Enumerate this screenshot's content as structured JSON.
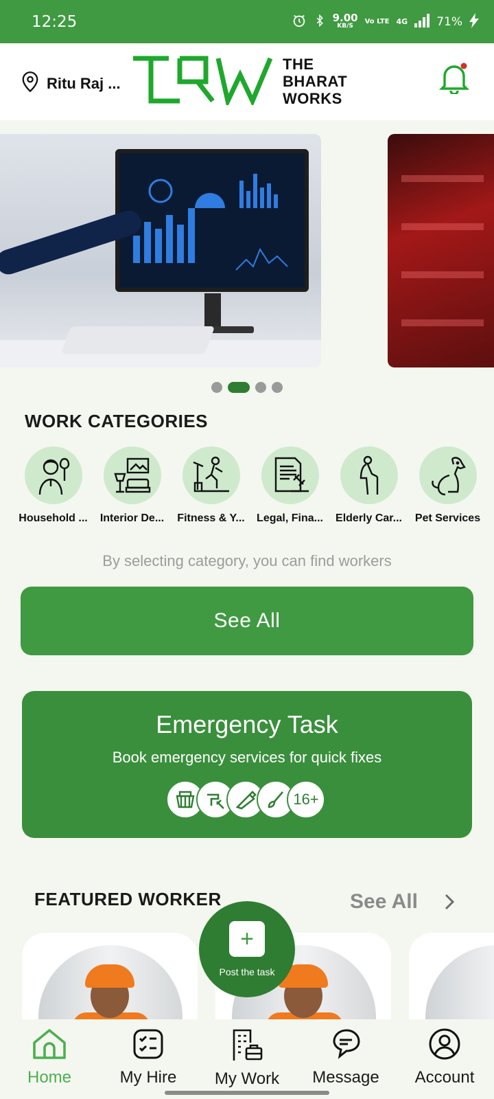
{
  "status_bar": {
    "time": "12:25",
    "net_speed": "9.00",
    "net_unit": "KB/S",
    "volte": "Vo LTE",
    "network": "4G",
    "battery": "71%"
  },
  "header": {
    "location": "Ritu Raj ...",
    "logo_words": [
      "THE",
      "BHARAT",
      "WORKS"
    ],
    "brand_color": "#1fa82c",
    "notification_dot_color": "#d32f2f"
  },
  "banner": {
    "active_slide_index": 1,
    "slide_count": 4
  },
  "categories": {
    "title": "WORK CATEGORIES",
    "items": [
      {
        "label": "Household ...",
        "icon": "housekeeper-icon"
      },
      {
        "label": "Interior De...",
        "icon": "interior-design-icon"
      },
      {
        "label": "Fitness & Y...",
        "icon": "fitness-icon"
      },
      {
        "label": "Legal, Fina...",
        "icon": "legal-document-icon"
      },
      {
        "label": "Elderly Car...",
        "icon": "elderly-care-icon"
      },
      {
        "label": "Pet Services",
        "icon": "dog-icon"
      }
    ],
    "hint": "By selecting category, you can find workers",
    "see_all": "See All"
  },
  "emergency": {
    "title": "Emergency Task",
    "subtitle": "Book emergency services for quick fixes",
    "icons": [
      "cleaning-basket-icon",
      "plumbing-icon",
      "saw-icon",
      "paint-brush-icon"
    ],
    "more_count": "16+"
  },
  "featured": {
    "title": "FEATURED WORKER",
    "see_all": "See All"
  },
  "fab": {
    "plus": "+",
    "label": "Post the task"
  },
  "bottom_nav": {
    "items": [
      {
        "label": "Home",
        "icon": "home-icon",
        "active": true
      },
      {
        "label": "My Hire",
        "icon": "checklist-icon",
        "active": false
      },
      {
        "label": "My Work",
        "icon": "office-briefcase-icon",
        "active": false
      },
      {
        "label": "Message",
        "icon": "chat-icon",
        "active": false
      },
      {
        "label": "Account",
        "icon": "user-icon",
        "active": false
      }
    ]
  },
  "colors": {
    "primary": "#3f9a41",
    "dark_primary": "#2f7d32",
    "category_bg": "#cfe9cd",
    "page_bg": "#f4f7ef"
  }
}
